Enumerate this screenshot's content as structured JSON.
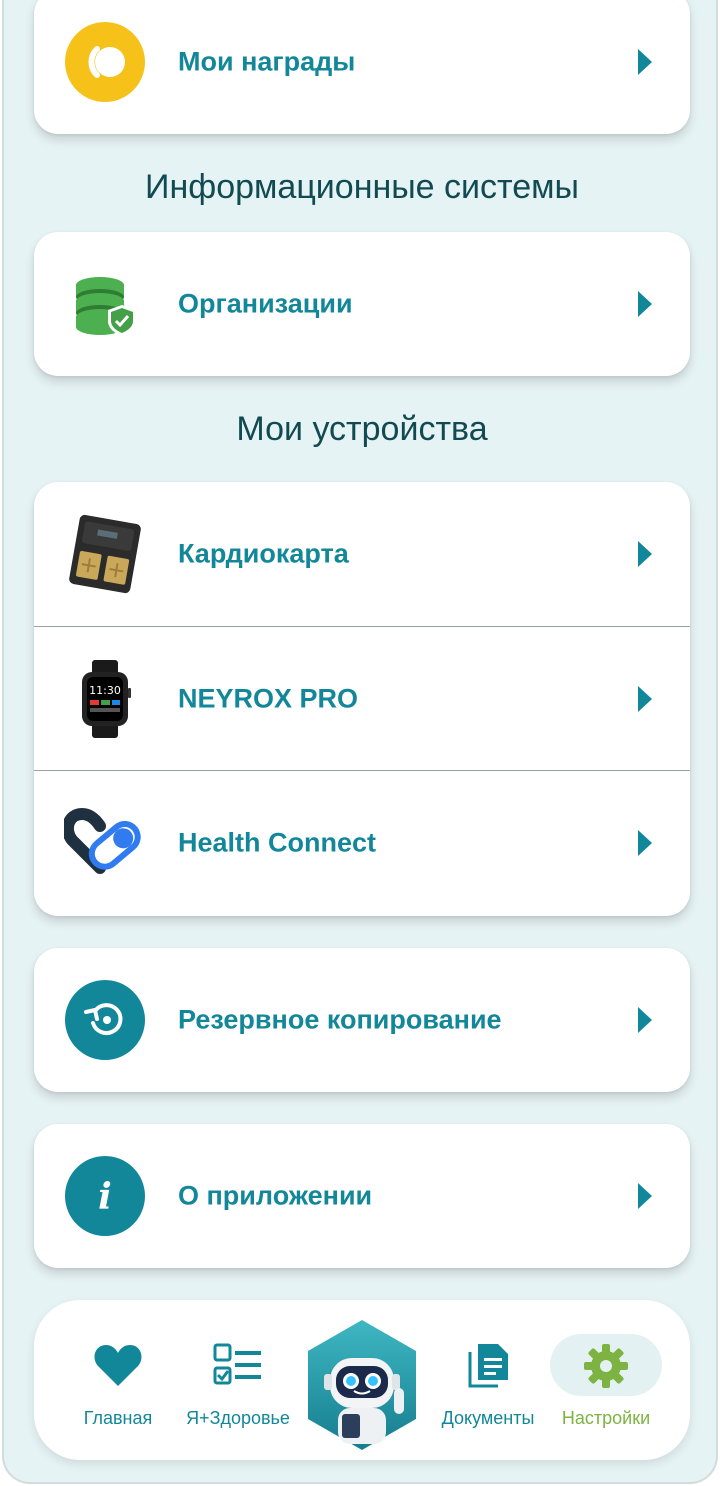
{
  "menu": {
    "rewards": {
      "label": "Мои награды",
      "icon": "rewards-icon"
    },
    "info_systems_title": "Информационные системы",
    "organizations": {
      "label": "Организации",
      "icon": "database-shield-icon"
    },
    "devices_title": "Мои устройства",
    "devices": [
      {
        "label": "Кардиокарта",
        "icon": "cardiocard-device-icon"
      },
      {
        "label": "NEYROX PRO",
        "icon": "smartwatch-icon"
      },
      {
        "label": "Health Connect",
        "icon": "health-connect-icon"
      }
    ],
    "backup": {
      "label": "Резервное копирование",
      "icon": "backup-restore-icon"
    },
    "about": {
      "label": "О приложении",
      "icon": "info-icon"
    }
  },
  "watch_time": "11:30",
  "nav": {
    "items": [
      {
        "label": "Главная",
        "icon": "heart-icon"
      },
      {
        "label": "Я+Здоровье",
        "icon": "checklist-icon"
      },
      {
        "label": "Документы",
        "icon": "documents-icon"
      },
      {
        "label": "Настройки",
        "icon": "gear-icon"
      }
    ],
    "active": "Настройки"
  },
  "colors": {
    "accent": "#13879a",
    "active": "#7db342",
    "background": "#e6f3f4",
    "rewards_yellow": "#f6c21a"
  }
}
